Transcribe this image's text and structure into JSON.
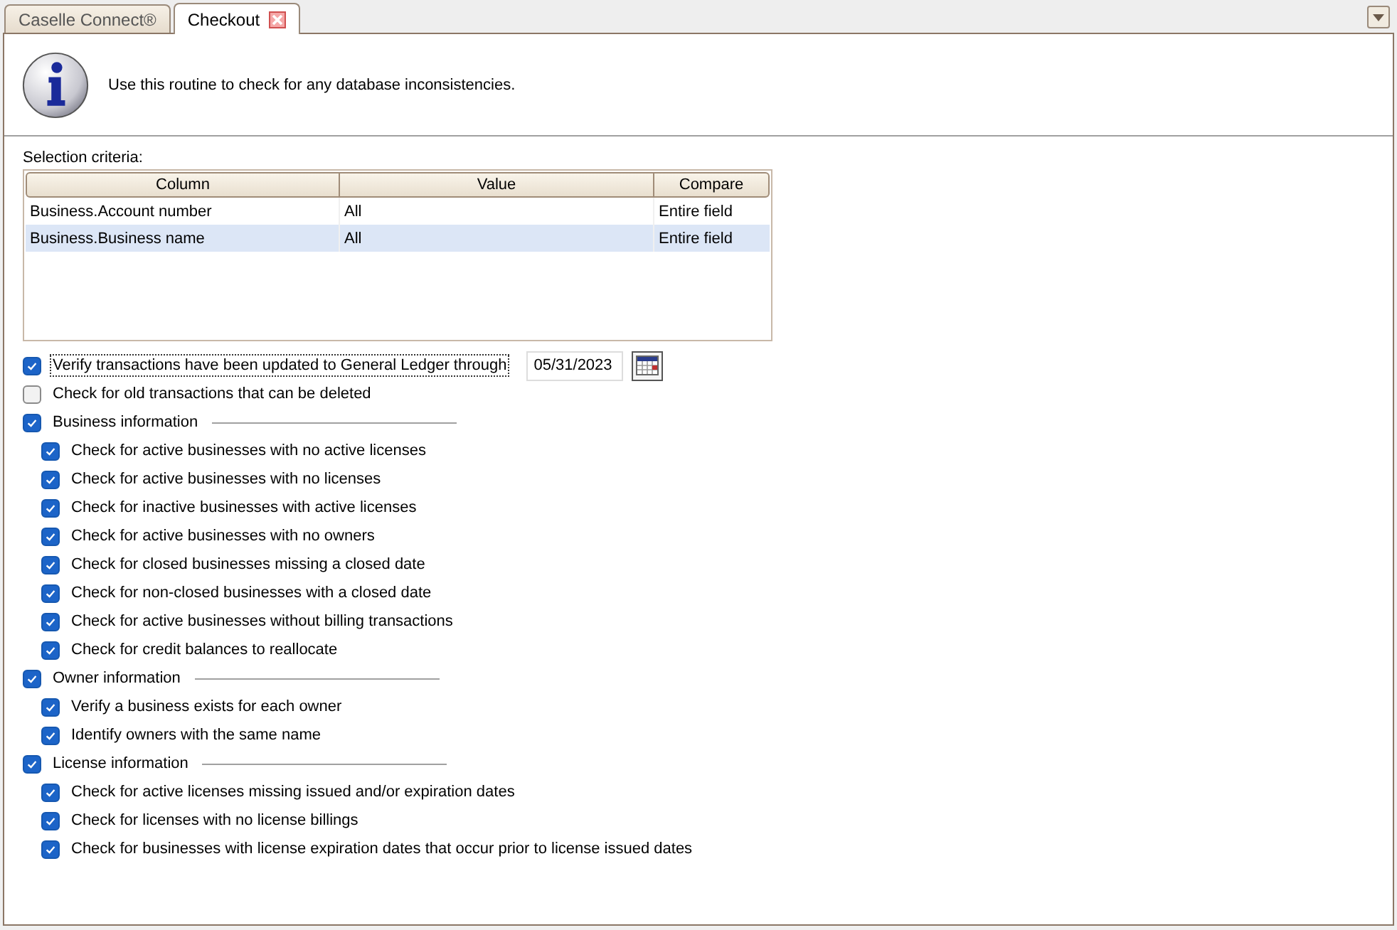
{
  "tabs": [
    {
      "label": "Caselle Connect®",
      "selected": false,
      "closable": false
    },
    {
      "label": "Checkout",
      "selected": true,
      "closable": true
    }
  ],
  "info_message": "Use this routine to check for any database inconsistencies.",
  "selection_criteria": {
    "label": "Selection criteria:",
    "columns": [
      "Column",
      "Value",
      "Compare"
    ],
    "rows": [
      {
        "cells": [
          "Business.Account number",
          "All",
          "Entire field"
        ],
        "selected": false
      },
      {
        "cells": [
          "Business.Business name",
          "All",
          "Entire field"
        ],
        "selected": true
      }
    ]
  },
  "checks": [
    {
      "label": "Verify transactions have been updated to General Ledger through",
      "checked": true,
      "focused": true,
      "date": "05/31/2023"
    },
    {
      "label": "Check for old transactions that can be deleted",
      "checked": false,
      "focused": false
    },
    {
      "label": "Business information",
      "checked": true,
      "focused": false,
      "children": [
        {
          "label": "Check for active businesses with no active licenses",
          "checked": true
        },
        {
          "label": "Check for active businesses with no licenses",
          "checked": true
        },
        {
          "label": "Check for inactive businesses with active licenses",
          "checked": true
        },
        {
          "label": "Check for active businesses with no owners",
          "checked": true
        },
        {
          "label": "Check for closed businesses missing a closed date",
          "checked": true
        },
        {
          "label": "Check for non-closed businesses with a closed date",
          "checked": true
        },
        {
          "label": "Check for active businesses without billing transactions",
          "checked": true
        },
        {
          "label": "Check for credit balances to reallocate",
          "checked": true
        }
      ]
    },
    {
      "label": "Owner information",
      "checked": true,
      "focused": false,
      "children": [
        {
          "label": "Verify a business exists for each owner",
          "checked": true
        },
        {
          "label": "Identify owners with the same name",
          "checked": true
        }
      ]
    },
    {
      "label": "License information",
      "checked": true,
      "focused": false,
      "children": [
        {
          "label": "Check for active licenses missing issued and/or expiration dates",
          "checked": true
        },
        {
          "label": "Check for licenses with no license billings",
          "checked": true
        },
        {
          "label": "Check for businesses with license expiration dates that occur prior to license issued dates",
          "checked": true
        }
      ]
    }
  ]
}
